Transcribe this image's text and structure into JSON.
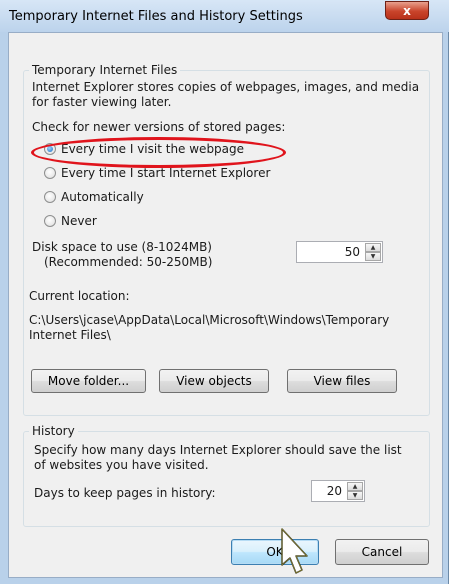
{
  "window": {
    "title": "Temporary Internet Files and History Settings",
    "close_label": "x"
  },
  "tif": {
    "legend": "Temporary Internet Files",
    "description_line1": "Internet Explorer stores copies of webpages, images, and media",
    "description_line2": "for faster viewing later.",
    "check_label": "Check for newer versions of stored pages:",
    "options": [
      {
        "label": "Every time I visit the webpage",
        "checked": true
      },
      {
        "label": "Every time I start Internet Explorer",
        "checked": false
      },
      {
        "label": "Automatically",
        "checked": false
      },
      {
        "label": "Never",
        "checked": false
      }
    ],
    "disk_label_line1": "Disk space to use (8-1024MB)",
    "disk_label_line2": "(Recommended: 50-250MB)",
    "disk_value": "50",
    "location_label": "Current location:",
    "location_line1": "C:\\Users\\jcase\\AppData\\Local\\Microsoft\\Windows\\Temporary",
    "location_line2": "Internet Files\\",
    "buttons": {
      "move_folder": "Move folder...",
      "view_objects": "View objects",
      "view_files": "View files"
    }
  },
  "history": {
    "legend": "History",
    "description_line1": "Specify how many days Internet Explorer should save the list",
    "description_line2": "of websites you have visited.",
    "days_label": "Days to keep pages in history:",
    "days_value": "20"
  },
  "dialog_buttons": {
    "ok": "OK",
    "cancel": "Cancel"
  },
  "colors": {
    "highlight": "#e0141c",
    "title_bar": "#bcd3ec",
    "close_button": "#c9442b"
  }
}
